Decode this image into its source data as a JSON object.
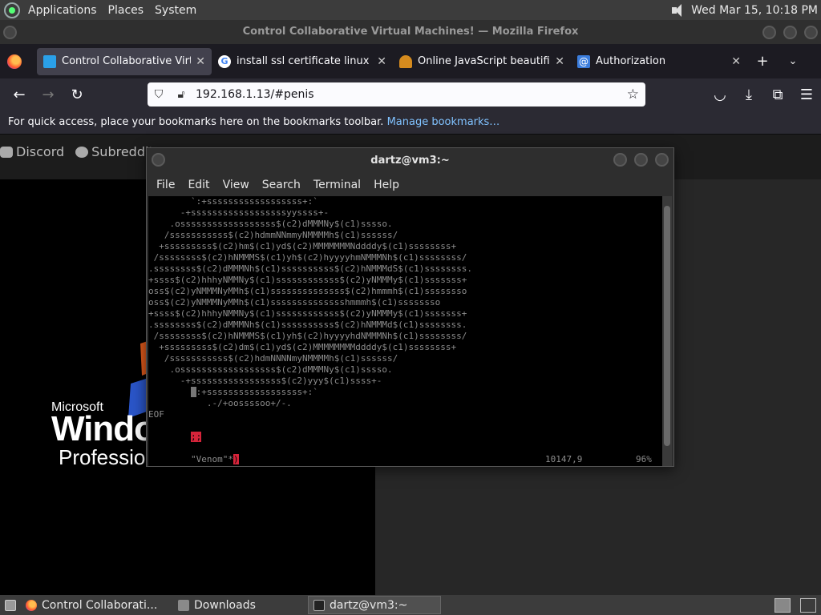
{
  "top_panel": {
    "menus": [
      "Applications",
      "Places",
      "System"
    ],
    "clock": "Wed Mar 15, 10:18 PM",
    "icons": [
      "distro-logo-icon",
      "volume-icon"
    ]
  },
  "firefox": {
    "window_title": "Control Collaborative Virtual Machines! — Mozilla Firefox",
    "tabs": [
      {
        "title": "Control Collaborative Virtual",
        "favicon": "monitor-icon",
        "favicon_color": "#2aa0e8",
        "active": true
      },
      {
        "title": "install ssl certificate linux - G",
        "favicon": "google-icon",
        "favicon_color": "#ffffff",
        "active": false
      },
      {
        "title": "Online JavaScript beautifier",
        "favicon": "js-beautifier-icon",
        "favicon_color": "#d58b1e",
        "active": false
      },
      {
        "title": "Authorization",
        "favicon": "at-sign-icon",
        "favicon_color": "#3b7ddd",
        "active": false
      }
    ],
    "url": "192.168.1.13/#penis",
    "bookmarks_text": "For quick access, place your bookmarks here on the bookmarks toolbar.",
    "bookmarks_link": "Manage bookmarks…"
  },
  "page": {
    "nav_items": [
      "Discord",
      "Subreddit"
    ],
    "vm_screen": {
      "microsoft": "Microsoft",
      "windows": "Windo",
      "edition": "Professio"
    }
  },
  "terminal": {
    "title": "dartz@vm3:~",
    "menus": [
      "File",
      "Edit",
      "View",
      "Search",
      "Terminal",
      "Help"
    ],
    "lines": [
      "        `:+ssssssssssssssssss+:`",
      "      -+ssssssssssssssssssyyssss+-",
      "    .ossssssssssssssssss$(c2)dMMMNy$(c1)sssso.",
      "   /sssssssssss$(c2)hdmmNNmmyNMMMMh$(c1)ssssss/",
      "  +sssssssss$(c2)hm$(c1)yd$(c2)MMMMMMMNddddy$(c1)ssssssss+",
      " /ssssssss$(c2)hNMMMS$(c1)yh$(c2)hyyyyhmNMMMNh$(c1)ssssssss/",
      ".ssssssss$(c2)dMMMNh$(c1)ssssssssss$(c2)hNMMMdS$(c1)ssssssss.",
      "+ssss$(c2)hhhyNMMNy$(c1)ssssssssssss$(c2)yNMMMy$(c1)sssssss+",
      "oss$(c2)yNMMMNyMMh$(c1)ssssssssssssss$(c2)hmmmh$(c1)ssssssso",
      "oss$(c2)yNMMMNyMMh$(c1)sssssssssssssshmmmh$(c1)ssssssso",
      "+ssss$(c2)hhhyNMMNy$(c1)ssssssssssss$(c2)yNMMMy$(c1)sssssss+",
      ".ssssssss$(c2)dMMMNh$(c1)ssssssssss$(c2)hNMMMd$(c1)ssssssss.",
      " /ssssssss$(c2)hNMMMS$(c1)yh$(c2)hyyyyhdNMMMNh$(c1)ssssssss/",
      "  +sssssssss$(c2)dm$(c1)yd$(c2)MMMMMMMMddddy$(c1)ssssssss+",
      "   /sssssssssss$(c2)hdmNNNNmyNMMMMh$(c1)ssssss/",
      "    .ossssssssssssssssss$(c2)dMMMNy$(c1)sssso.",
      "      -+sssssssssssssssss$(c2)yyy$(c1)ssss+-"
    ],
    "cursor_char": " ",
    "cursor_line_rest": ":+ssssssssssssssssss+:`",
    "line_after": "           .-/+oossssoo+/-.",
    "eof": "EOF",
    "red_token": ";;",
    "venom_text": "\"Venom\"*",
    "venom_close": ")",
    "position": "10147,9",
    "percent": "96%"
  },
  "taskbar": {
    "items": [
      {
        "label": "Control Collaborati...",
        "icon": "firefox-icon",
        "active": false
      },
      {
        "label": "Downloads",
        "icon": "folder-icon",
        "active": false
      },
      {
        "label": "dartz@vm3:~",
        "icon": "terminal-icon",
        "active": true
      }
    ]
  }
}
